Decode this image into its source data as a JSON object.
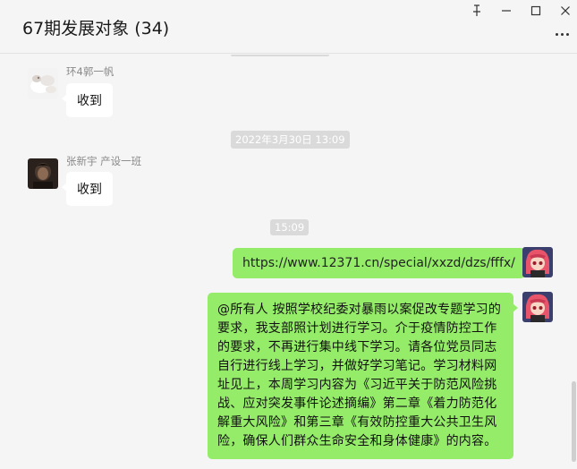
{
  "window": {
    "title": "67期发展对象 (34)",
    "controls": {
      "pin": "⚲",
      "minimize": "—",
      "maximize": "☐",
      "close": "✕"
    }
  },
  "messages": [
    {
      "sender": "环4郭一帆",
      "text": "收到",
      "avatar": "cat-photo-avatar"
    },
    {
      "timestamp": "2022年3月30日 13:09"
    },
    {
      "sender": "张新宇 产设一班",
      "text": "收到",
      "avatar": "dark-portrait-avatar"
    },
    {
      "timestamp": "15:09"
    },
    {
      "self": true,
      "text": "https://www.12371.cn/special/xxzd/dzs/fffx/"
    },
    {
      "self": true,
      "text": "@所有人 按照学校纪委对暴雨以案促改专题学习的要求，我支部照计划进行学习。介于疫情防控工作的要求，不再进行集中线下学习。请各位党员同志自行进行线上学习，并做好学习笔记。学习材料网址见上，本周学习内容为《习近平关于防范风险挑战、应对突发事件论述摘编》第二章《着力防范化解重大风险》和第三章《有效防控重大公共卫生风险，确保人们群众生命安全和身体健康》的内容。"
    }
  ],
  "colors": {
    "background": "#f5f5f5",
    "incoming_bubble": "#ffffff",
    "outgoing_bubble": "#95ec69",
    "timestamp_badge": "#dadada"
  }
}
